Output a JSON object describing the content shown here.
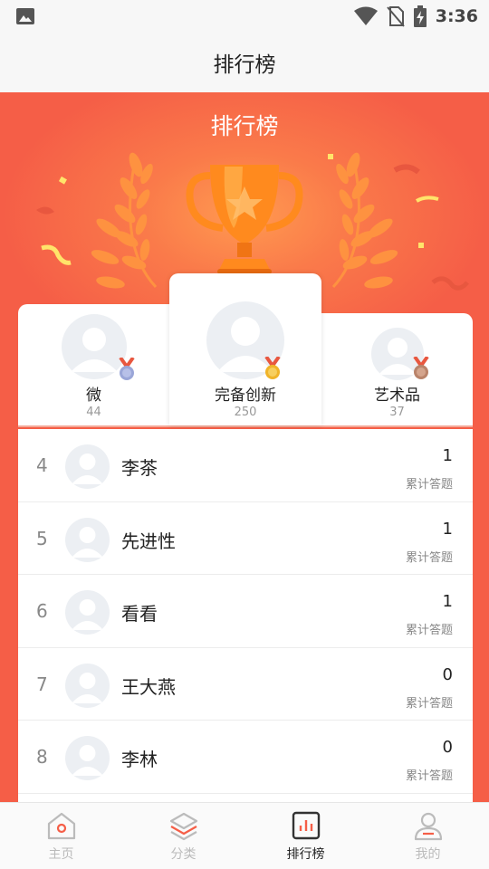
{
  "status_bar": {
    "time": "3:36"
  },
  "app_bar": {
    "title": "排行榜"
  },
  "banner": {
    "title": "排行榜"
  },
  "podium": {
    "first": {
      "name": "完备创新",
      "score": "250"
    },
    "second": {
      "name": "微",
      "score": "44"
    },
    "third": {
      "name": "艺术品",
      "score": "37"
    }
  },
  "ranking": [
    {
      "rank": "4",
      "name": "李茶",
      "count": "1",
      "count_label": "累计答题"
    },
    {
      "rank": "5",
      "name": "先进性",
      "count": "1",
      "count_label": "累计答题"
    },
    {
      "rank": "6",
      "name": "看看",
      "count": "1",
      "count_label": "累计答题"
    },
    {
      "rank": "7",
      "name": "王大燕",
      "count": "0",
      "count_label": "累计答题"
    },
    {
      "rank": "8",
      "name": "李林",
      "count": "0",
      "count_label": "累计答题"
    }
  ],
  "bottom_nav": [
    {
      "label": "主页",
      "icon": "home-icon"
    },
    {
      "label": "分类",
      "icon": "layers-icon"
    },
    {
      "label": "排行榜",
      "icon": "leaderboard-icon",
      "active": true
    },
    {
      "label": "我的",
      "icon": "profile-icon"
    }
  ],
  "colors": {
    "brand": "#f55e47",
    "trophy": "#ff8a1e",
    "gold_medal": "#f0b429",
    "silver_medal": "#9aa6d8",
    "bronze_medal": "#b9836a"
  }
}
